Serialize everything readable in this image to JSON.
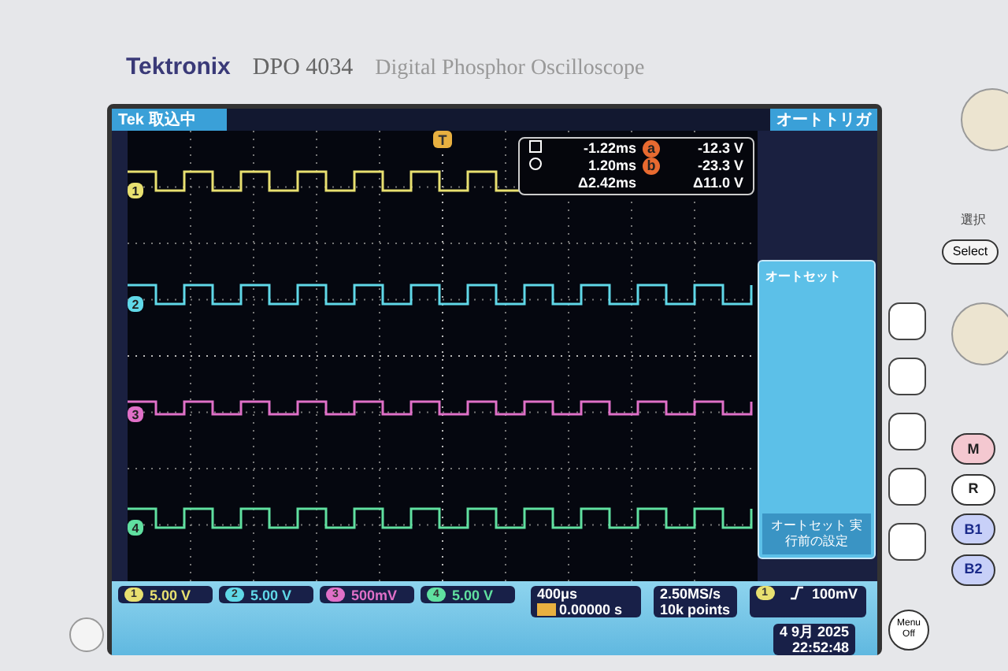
{
  "header": {
    "brand": "Tektronix",
    "model": "DPO 4034",
    "product": "Digital Phosphor Oscilloscope"
  },
  "status_bar": {
    "logo": "Tek",
    "state": "取込中",
    "trigger_mode": "オートトリガ"
  },
  "trigger_marker": "T",
  "channels": [
    {
      "marker_label": "1",
      "label": "1",
      "color": "#e8e070",
      "scale": "5.00 V"
    },
    {
      "marker_label": "2",
      "label": "2",
      "color": "#60d8e8",
      "scale": "5.00 V"
    },
    {
      "marker_label": "3",
      "label": "3",
      "color": "#e070c8",
      "scale": "500mV"
    },
    {
      "marker_label": "4",
      "label": "4",
      "color": "#60e0a0",
      "scale": "5.00 V"
    }
  ],
  "cursors": {
    "rows": [
      {
        "time": "-1.22ms",
        "marker": "a",
        "value": "-12.3 V"
      },
      {
        "time": "1.20ms",
        "marker": "b",
        "value": "-23.3 V"
      }
    ],
    "delta_time": "Δ2.42ms",
    "delta_value": "Δ11.0 V"
  },
  "timebase": {
    "scale": "400μs",
    "position": "0.00000 s"
  },
  "acquisition": {
    "rate": "2.50MS/s",
    "record": "10k points"
  },
  "trigger": {
    "source": "1",
    "level": "100mV"
  },
  "datetime": {
    "date": "4 9月 2025",
    "time": "22:52:48"
  },
  "side_menu": {
    "title": "オートセット",
    "items": [
      {
        "label": "オートセット 実行前の設定",
        "disabled": true
      }
    ]
  },
  "bezel": {
    "select_caption": "選択",
    "select": "Select",
    "buttons": [
      "M",
      "R",
      "B1",
      "B2"
    ],
    "menu_off": "Menu Off"
  }
}
